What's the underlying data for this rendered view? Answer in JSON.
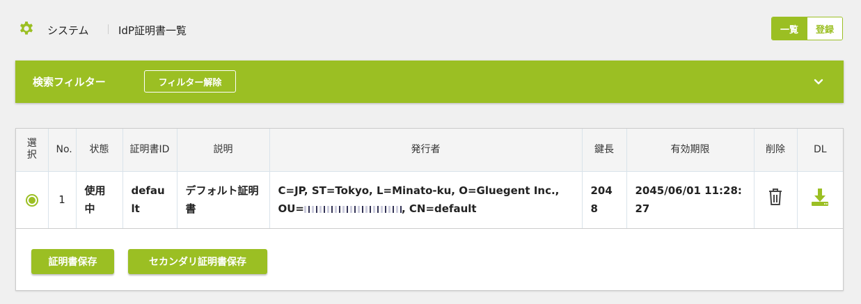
{
  "header": {
    "icon": "gear-icon",
    "breadcrumb_system": "システム",
    "page_title": "IdP証明書一覧",
    "toggle_list": "一覧",
    "toggle_register": "登録"
  },
  "filter": {
    "title": "検索フィルター",
    "clear_label": "フィルター解除",
    "expand_icon": "chevron-down-icon"
  },
  "table": {
    "columns": [
      "選択",
      "No.",
      "状態",
      "証明書ID",
      "説明",
      "発行者",
      "鍵長",
      "有効期限",
      "削除",
      "DL"
    ],
    "rows": [
      {
        "selected": true,
        "no": "1",
        "status": "使用中",
        "cert_id": "default",
        "description": "デフォルト証明書",
        "issuer_line1": "C=JP, ST=Tokyo, L=Minato-ku, O=Gluegent Inc.,",
        "issuer_ou_prefix": "OU=",
        "issuer_line2_suffix": ", CN=default",
        "key_length": "2048",
        "expiry": "2045/06/01 11:28:27",
        "delete_icon": "trash-icon",
        "download_icon": "download-icon"
      }
    ]
  },
  "actions": {
    "save_cert": "証明書保存",
    "save_secondary_cert": "セカンダリ証明書保存"
  },
  "colors": {
    "accent": "#9bbf23",
    "background": "#f0f0f0"
  }
}
